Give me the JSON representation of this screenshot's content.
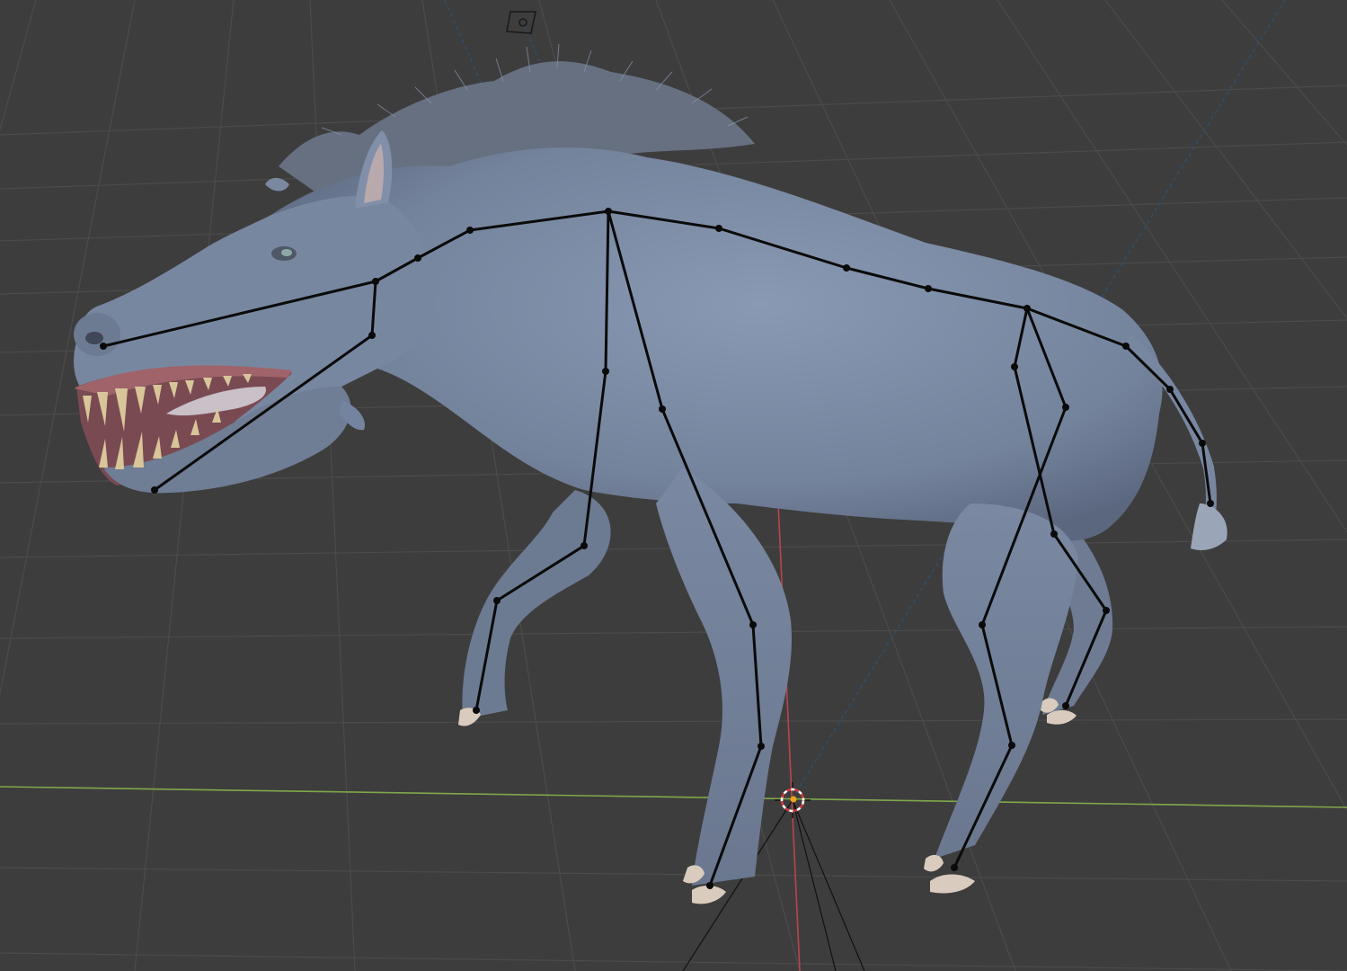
{
  "app": "3D viewport",
  "colors": {
    "background": "#3d3d3d",
    "grid": "#4a4a4a",
    "x_axis": "#b8454d",
    "y_axis": "#7fa84a",
    "creature_skin": "#7b8aa3",
    "creature_shadow": "#55617a",
    "bones": "#0a0a0a",
    "teeth": "#d8c69a",
    "gums": "#a0636a",
    "hooves": "#d9cbbd",
    "camera_line": "#2f4f6b"
  },
  "icons": {
    "light": "light-object-icon",
    "cursor": "3d-cursor-icon",
    "origin": "object-origin-icon"
  },
  "scene": {
    "object": "boar-creature",
    "armature": "boar-armature",
    "view": "perspective"
  }
}
